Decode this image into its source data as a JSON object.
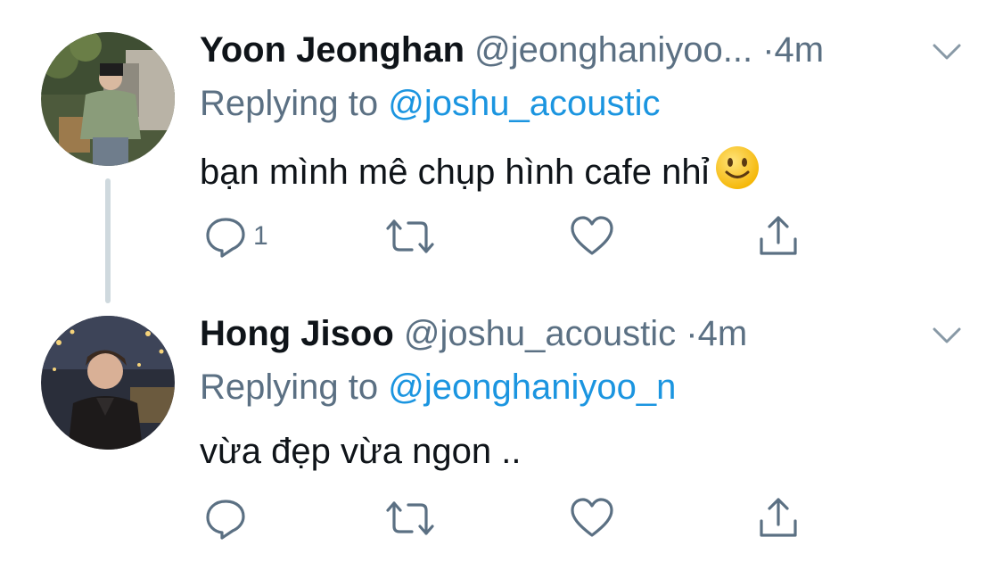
{
  "tweets": [
    {
      "name": "Yoon Jeonghan",
      "handle": "@jeonghaniyoo...",
      "dot": "·",
      "time": "4m",
      "replying_prefix": "Replying to",
      "replying_handle": "@joshu_acoustic",
      "text": "bạn mình mê chụp hình cafe nhỉ",
      "emoji": "slightly-smiling-face",
      "reply_count": "1"
    },
    {
      "name": "Hong Jisoo",
      "handle": "@joshu_acoustic",
      "dot": "·",
      "time": "4m",
      "replying_prefix": "Replying to",
      "replying_handle": "@jeonghaniyoo_n",
      "text": "vừa đẹp vừa ngon ..",
      "reply_count": ""
    }
  ],
  "colors": {
    "accent": "#1b95e0",
    "secondary_text": "#5b7083",
    "thread_line": "#cfd9de"
  },
  "icons": [
    "reply-icon",
    "retweet-icon",
    "like-icon",
    "share-icon",
    "chevron-down-icon"
  ]
}
